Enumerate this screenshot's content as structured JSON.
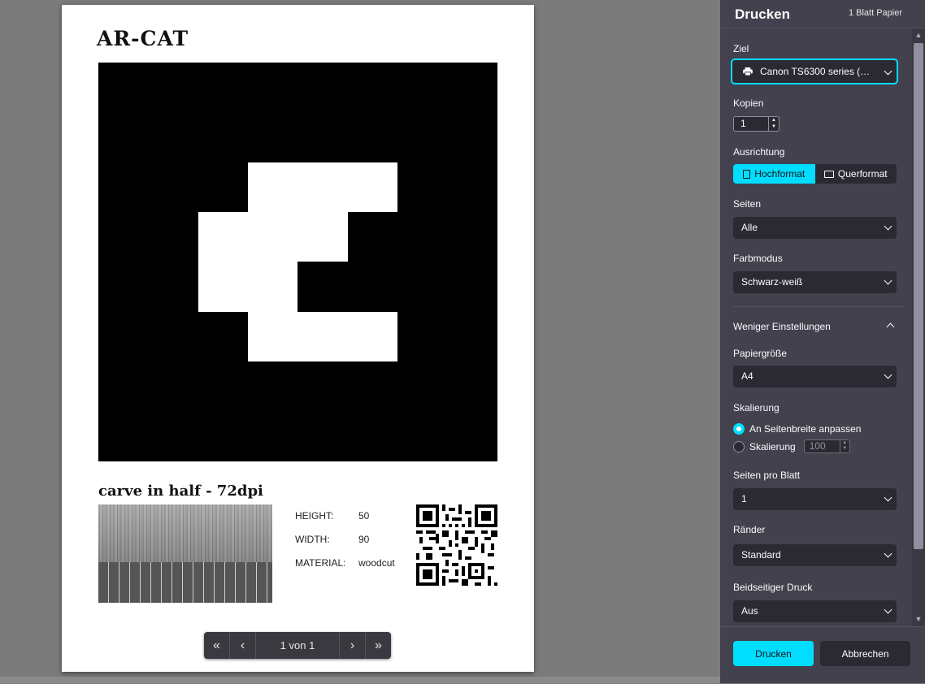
{
  "sheet": {
    "brand": "AR-CAT",
    "caption": "carve in half - 72dpi",
    "specs": [
      {
        "key": "HEIGHT:",
        "value": "50"
      },
      {
        "key": "WIDTH:",
        "value": "90"
      },
      {
        "key": "MATERIAL:",
        "value": "woodcut"
      }
    ]
  },
  "pager": {
    "first": "«",
    "prev": "‹",
    "label": "1 von 1",
    "next": "›",
    "last": "»"
  },
  "panel": {
    "title": "Drucken",
    "sheet_count": "1 Blatt Papier",
    "destination": {
      "label": "Ziel",
      "value": "Canon TS6300 series (…"
    },
    "copies": {
      "label": "Kopien",
      "value": "1"
    },
    "orientation": {
      "label": "Ausrichtung",
      "portrait": "Hochformat",
      "landscape": "Querformat",
      "selected": "portrait"
    },
    "pages": {
      "label": "Seiten",
      "value": "Alle"
    },
    "color_mode": {
      "label": "Farbmodus",
      "value": "Schwarz-weiß"
    },
    "fewer_settings": "Weniger Einstellungen",
    "paper_size": {
      "label": "Papiergröße",
      "value": "A4"
    },
    "scaling": {
      "label": "Skalierung",
      "fit": "An Seitenbreite anpassen",
      "custom": "Skalierung",
      "custom_value": "100",
      "selected": "fit"
    },
    "pages_per_sheet": {
      "label": "Seiten pro Blatt",
      "value": "1"
    },
    "margins": {
      "label": "Ränder",
      "value": "Standard"
    },
    "duplex": {
      "label": "Beidseitiger Druck",
      "value": "Aus"
    },
    "print_button": "Drucken",
    "cancel_button": "Abbrechen"
  },
  "colors": {
    "accent": "#00ddff",
    "panel_bg": "#42414d",
    "field_bg": "#2b2a33"
  }
}
